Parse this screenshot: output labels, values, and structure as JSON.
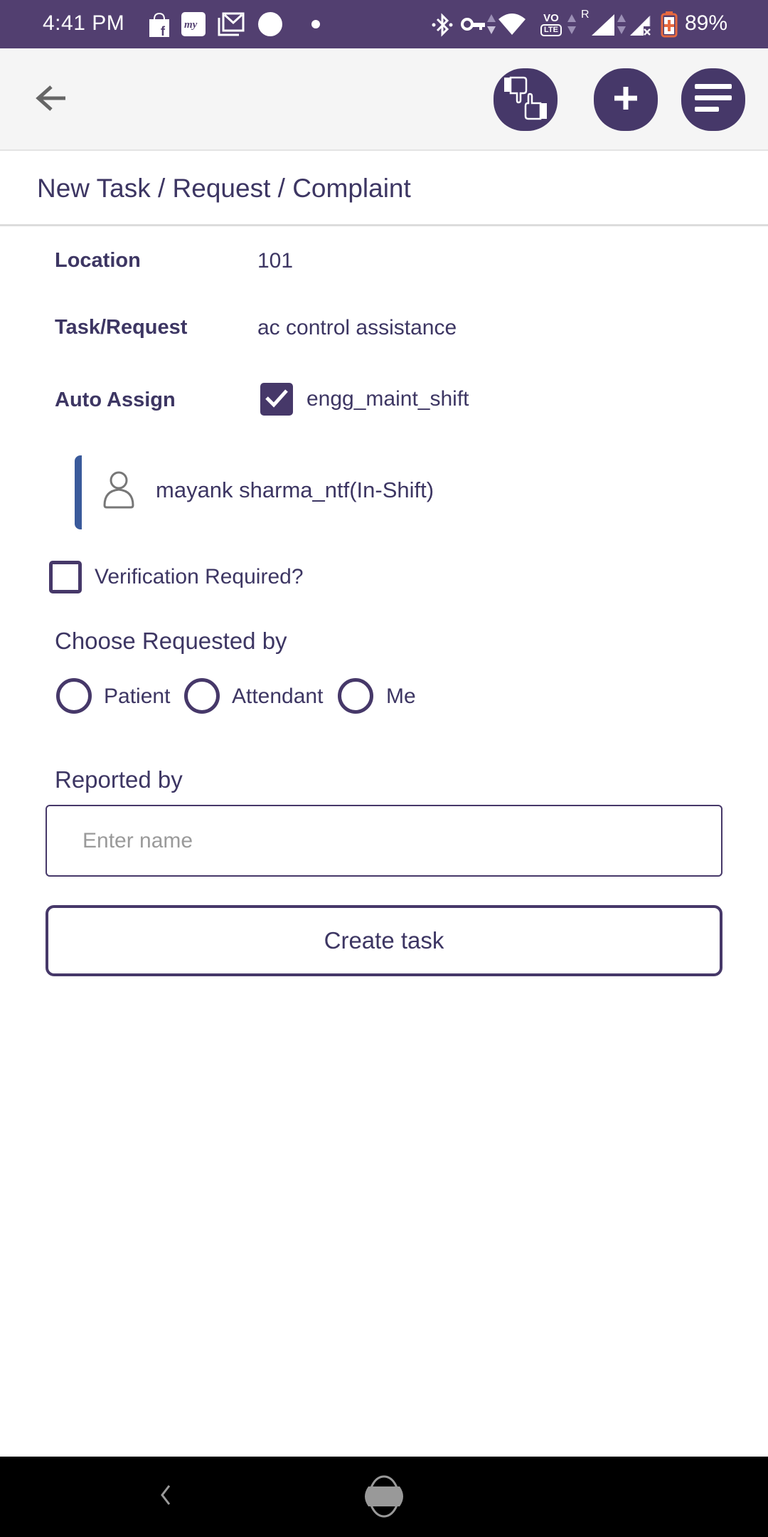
{
  "status_bar": {
    "time": "4:41 PM",
    "notification_icons": [
      "flipkart-icon",
      "mytrip-icon",
      "gmail-icon",
      "circle-icon",
      "dot-icon"
    ],
    "system_icons": [
      "bluetooth-icon",
      "vpn-key-icon",
      "wifi-icon",
      "volte-icon",
      "signal-roaming-icon",
      "signal-no-sim-icon",
      "battery-charging-icon"
    ],
    "roaming_indicator": "R",
    "volte_label": "VO",
    "lte_label": "LTE",
    "battery_percent": "89%"
  },
  "app_bar": {
    "back_icon": "arrow-left-icon",
    "actions": [
      {
        "name": "feedback",
        "icon": "thumbs-up-down-icon"
      },
      {
        "name": "add",
        "icon": "plus-icon"
      },
      {
        "name": "menu",
        "icon": "menu-icon"
      }
    ]
  },
  "page": {
    "title": "New Task / Request / Complaint"
  },
  "form": {
    "location": {
      "label": "Location",
      "value": "101"
    },
    "task_request": {
      "label": "Task/Request",
      "value": "ac control assistance"
    },
    "auto_assign": {
      "label": "Auto Assign",
      "checked": true,
      "group": "engg_maint_shift"
    },
    "assignee": {
      "name": "mayank sharma_ntf(In-Shift)"
    },
    "verification": {
      "label": "Verification Required?",
      "checked": false
    },
    "requested_by": {
      "label": "Choose Requested by",
      "options": [
        {
          "label": "Patient",
          "selected": false
        },
        {
          "label": "Attendant",
          "selected": false
        },
        {
          "label": "Me",
          "selected": false
        }
      ]
    },
    "reported_by": {
      "label": "Reported by",
      "placeholder": "Enter name",
      "value": ""
    },
    "submit_label": "Create task"
  },
  "colors": {
    "primary": "#463869",
    "status_bar": "#523f70",
    "text": "#3d3663",
    "assignee_accent": "#3a5a9b",
    "placeholder": "#9a9a9a"
  }
}
